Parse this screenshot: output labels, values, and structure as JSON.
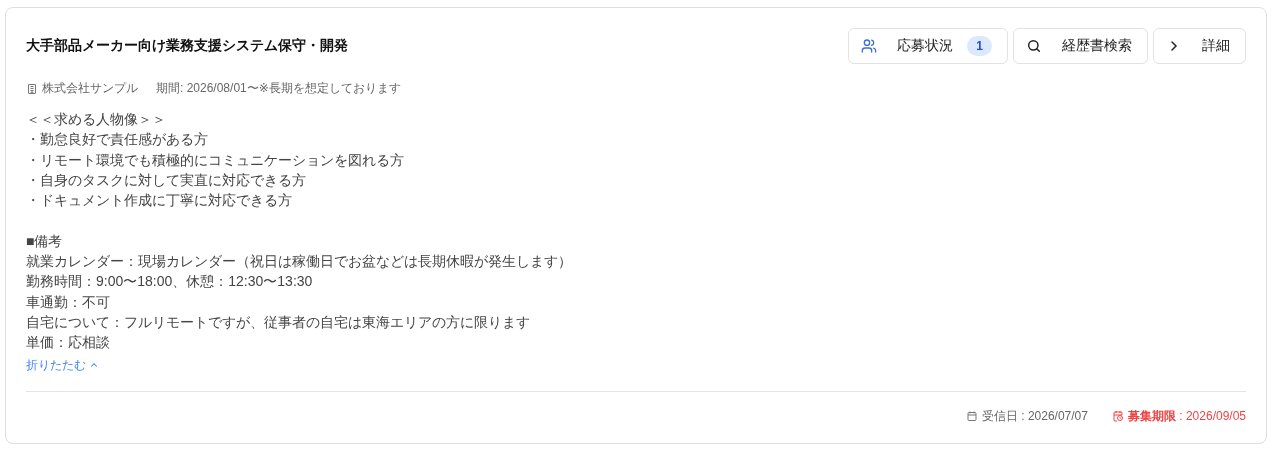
{
  "job": {
    "title": "大手部品メーカー向け業務支援システム保守・開発",
    "actions": [
      {
        "kind": "applicants",
        "label": "応募状況",
        "badge": "1"
      },
      {
        "kind": "search",
        "label": "経歴書検索"
      },
      {
        "kind": "detail",
        "label": "詳細"
      }
    ],
    "company": "株式会社サンプル",
    "period": "期間: 2026/08/01〜※長期を想定しております",
    "sections": [
      {
        "lines": [
          "＜＜求める人物像＞＞",
          "・勤怠良好で責任感がある方",
          "・リモート環境でも積極的にコミュニケーションを図れる方",
          "・自身のタスクに対して実直に対応できる方",
          "・ドキュメント作成に丁寧に対応できる方"
        ]
      },
      {
        "lines": [
          "■備考",
          "就業カレンダー：現場カレンダー（祝日は稼働日でお盆などは長期休暇が発生します）",
          "勤務時間：9:00〜18:00、休憩：12:30〜13:30",
          "車通勤：不可",
          "自宅について：フルリモートですが、従事者の自宅は東海エリアの方に限ります",
          "単価：応相談"
        ]
      }
    ],
    "collapse_link": {
      "label": "折りたたむ",
      "expanded": true
    },
    "received": "受信日 : 2026/07/07",
    "deadline": "**募集期限** : 2026/09/05"
  }
}
